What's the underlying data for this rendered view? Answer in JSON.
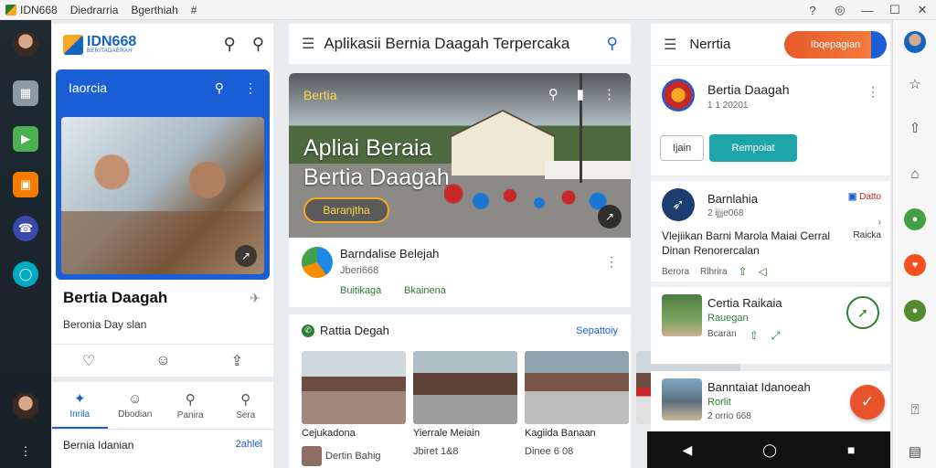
{
  "titlebar": {
    "app_title": "IDN668",
    "tab1": "Diedrarria",
    "tab2": "Bgerthiah",
    "tab3": "#",
    "controls": [
      "?",
      "◎",
      "—",
      "☐",
      "✕"
    ]
  },
  "dock": {
    "icons": [
      "avatar",
      "photo-icon",
      "play-store-icon",
      "app-icon",
      "phone-icon",
      "chat-icon",
      "avatar",
      "more-icon"
    ]
  },
  "col1": {
    "logo_text": "IDN668",
    "logo_sub": "BERITADAERAH",
    "card_header": "Iaorcia",
    "title": "Bertia Daagah",
    "subtitle": "Beronia Day slan",
    "tabs": [
      {
        "label": "Inrila",
        "icon": "★"
      },
      {
        "label": "Dbodian",
        "icon": "☺"
      },
      {
        "label": "Panira",
        "icon": "⚲"
      },
      {
        "label": "Sera",
        "icon": "⚲"
      }
    ],
    "footer_left": "Bernia Idanian",
    "footer_right": "2ahlel"
  },
  "col2": {
    "app_bar_title": "Aplikasii Bernia Daagah Terpercaka",
    "hero_badge": "Bertia",
    "hero_title_line1": "Apliai Beraia",
    "hero_title_line2": "Bertia Daagah",
    "hero_button": "Baranjtha",
    "article_title": "Barndalise Belejah",
    "article_date": "Jberi668",
    "article_tag1": "Buitikaga",
    "article_tag2": "Bkainena",
    "gallery_title": "Rattia Degah",
    "gallery_link": "Sepattoiy",
    "captions": [
      "Cejukadona",
      "Yierrale Meiain",
      "Kagiida Banaan",
      ""
    ],
    "row2": [
      "Dertin Bahig",
      "Jbiret 1&8",
      "Dinee 6 08",
      ""
    ]
  },
  "col3": {
    "app_bar_title": "Nerrtia",
    "pill": "Ibqepagian",
    "profile_name": "Bertia Daagah",
    "profile_meta": "1 1 20201",
    "btn_outline": "Ijain",
    "btn_solid": "Rempoiat",
    "news1_title": "Barnlahia",
    "news1_date": "2 ijjje068",
    "news1_tag": "Datto",
    "news1_headline": "Vlejiikan Barni Marola Maiai Cerral Dinan Renorercalan",
    "news1_right": "Raicka",
    "news1_meta1": "Berora",
    "news1_meta2": "Rlhrira",
    "news2_title": "Certia Raikaia",
    "news2_sub": "Rauegan",
    "news2_meta": "Bcaran",
    "news3_title": "Banntaiat Idanoeah",
    "news3_sub": "Rorlit",
    "news3_meta": "2 orrio 668"
  }
}
